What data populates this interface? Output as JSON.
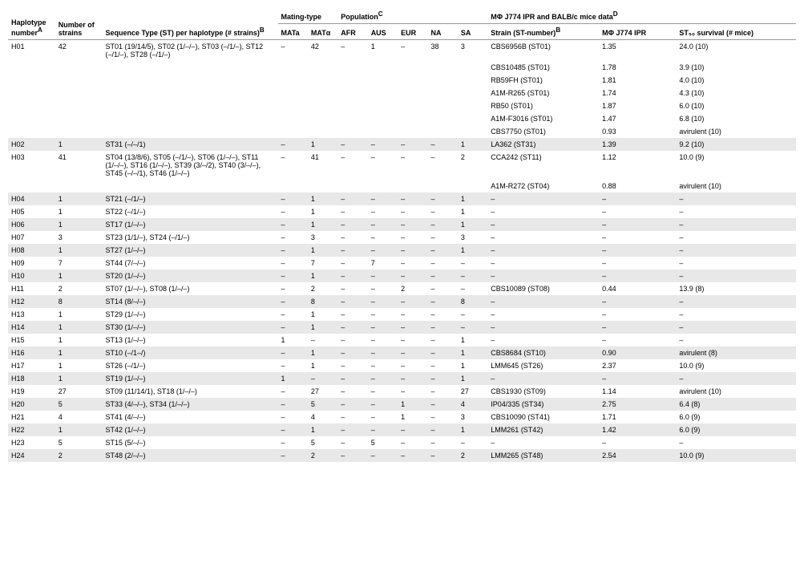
{
  "headers": {
    "haplotype": "Haplotype number",
    "haplotype_sup": "A",
    "nstrains": "Number of strains",
    "stper": "Sequence Type (ST) per haplotype (# strains)",
    "stper_sup": "B",
    "mating": "Mating-type",
    "MATa": "MATa",
    "MATalpha": "MATα",
    "population": "Population",
    "population_sup": "C",
    "AFR": "AFR",
    "AUS": "AUS",
    "EUR": "EUR",
    "NA": "NA",
    "SA": "SA",
    "mphi": "MΦ J774 IPR and BALB/c mice data",
    "mphi_sup": "D",
    "strain": "Strain (ST-number)",
    "strain_sup": "B",
    "ipr": "MΦ J774 IPR",
    "st50": "ST₅₀ survival (# mice)"
  },
  "chart_data": {
    "type": "table",
    "rows": [
      {
        "H": "H01",
        "N": "42",
        "ST": "ST01 (19/14/5), ST02 (1/–/–), ST03 (–/1/–), ST12 (–/1/–), ST28 (–/1/–)",
        "MATa": "–",
        "MATalpha": "42",
        "AFR": "–",
        "AUS": "1",
        "EUR": "–",
        "NA": "38",
        "SA": "3",
        "strain": "CBS6956B (ST01)",
        "IPR": "1.35",
        "ST50": "24.0 (10)"
      },
      {
        "H": "",
        "N": "",
        "ST": "",
        "MATa": "",
        "MATalpha": "",
        "AFR": "",
        "AUS": "",
        "EUR": "",
        "NA": "",
        "SA": "",
        "strain": "CBS10485 (ST01)",
        "IPR": "1.78",
        "ST50": "3.9 (10)"
      },
      {
        "H": "",
        "N": "",
        "ST": "",
        "MATa": "",
        "MATalpha": "",
        "AFR": "",
        "AUS": "",
        "EUR": "",
        "NA": "",
        "SA": "",
        "strain": "RB59FH (ST01)",
        "IPR": "1.81",
        "ST50": "4.0 (10)"
      },
      {
        "H": "",
        "N": "",
        "ST": "",
        "MATa": "",
        "MATalpha": "",
        "AFR": "",
        "AUS": "",
        "EUR": "",
        "NA": "",
        "SA": "",
        "strain": "A1M-R265 (ST01)",
        "IPR": "1.74",
        "ST50": "4.3 (10)"
      },
      {
        "H": "",
        "N": "",
        "ST": "",
        "MATa": "",
        "MATalpha": "",
        "AFR": "",
        "AUS": "",
        "EUR": "",
        "NA": "",
        "SA": "",
        "strain": "RB50 (ST01)",
        "IPR": "1.87",
        "ST50": "6.0 (10)"
      },
      {
        "H": "",
        "N": "",
        "ST": "",
        "MATa": "",
        "MATalpha": "",
        "AFR": "",
        "AUS": "",
        "EUR": "",
        "NA": "",
        "SA": "",
        "strain": "A1M-F3016 (ST01)",
        "IPR": "1.47",
        "ST50": "6.8 (10)"
      },
      {
        "H": "",
        "N": "",
        "ST": "",
        "MATa": "",
        "MATalpha": "",
        "AFR": "",
        "AUS": "",
        "EUR": "",
        "NA": "",
        "SA": "",
        "strain": "CBS7750 (ST01)",
        "IPR": "0.93",
        "ST50": "avirulent (10)"
      },
      {
        "H": "H02",
        "N": "1",
        "ST": "ST31 (–/–/1)",
        "MATa": "–",
        "MATalpha": "1",
        "AFR": "–",
        "AUS": "–",
        "EUR": "–",
        "NA": "–",
        "SA": "1",
        "strain": "LA362 (ST31)",
        "IPR": "1.39",
        "ST50": "9.2 (10)"
      },
      {
        "H": "H03",
        "N": "41",
        "ST": "ST04 (13/8/6), ST05 (–/1/–), ST06 (1/–/–), ST11 (1/–/–), ST16 (1/–/–), ST39 (3/–/2), ST40 (3/–/–), ST45 (–/–/1), ST46 (1/–/–)",
        "MATa": "–",
        "MATalpha": "41",
        "AFR": "–",
        "AUS": "–",
        "EUR": "–",
        "NA": "–",
        "SA": "2",
        "strain": "CCA242 (ST11)",
        "IPR": "1.12",
        "ST50": "10.0 (9)"
      },
      {
        "H": "",
        "N": "",
        "ST": "",
        "MATa": "",
        "MATalpha": "",
        "AFR": "",
        "AUS": "",
        "EUR": "",
        "NA": "",
        "SA": "",
        "strain": "A1M-R272 (ST04)",
        "IPR": "0.88",
        "ST50": "avirulent (10)"
      },
      {
        "H": "H04",
        "N": "1",
        "ST": "ST21 (–/1/–)",
        "MATa": "–",
        "MATalpha": "1",
        "AFR": "–",
        "AUS": "–",
        "EUR": "–",
        "NA": "–",
        "SA": "1",
        "strain": "–",
        "IPR": "–",
        "ST50": "–"
      },
      {
        "H": "H05",
        "N": "1",
        "ST": "ST22 (–/1/–)",
        "MATa": "–",
        "MATalpha": "1",
        "AFR": "–",
        "AUS": "–",
        "EUR": "–",
        "NA": "–",
        "SA": "1",
        "strain": "–",
        "IPR": "–",
        "ST50": "–"
      },
      {
        "H": "H06",
        "N": "1",
        "ST": "ST17 (1/–/–)",
        "MATa": "–",
        "MATalpha": "1",
        "AFR": "–",
        "AUS": "–",
        "EUR": "–",
        "NA": "–",
        "SA": "1",
        "strain": "–",
        "IPR": "–",
        "ST50": "–"
      },
      {
        "H": "H07",
        "N": "3",
        "ST": "ST23 (1/1/–), ST24 (–/1/–)",
        "MATa": "–",
        "MATalpha": "3",
        "AFR": "–",
        "AUS": "–",
        "EUR": "–",
        "NA": "–",
        "SA": "3",
        "strain": "–",
        "IPR": "–",
        "ST50": "–"
      },
      {
        "H": "H08",
        "N": "1",
        "ST": "ST27 (1/–/–)",
        "MATa": "–",
        "MATalpha": "1",
        "AFR": "–",
        "AUS": "–",
        "EUR": "–",
        "NA": "–",
        "SA": "1",
        "strain": "–",
        "IPR": "–",
        "ST50": "–"
      },
      {
        "H": "H09",
        "N": "7",
        "ST": "ST44 (7/–/–)",
        "MATa": "–",
        "MATalpha": "7",
        "AFR": "–",
        "AUS": "7",
        "EUR": "–",
        "NA": "–",
        "SA": "–",
        "strain": "–",
        "IPR": "–",
        "ST50": "–"
      },
      {
        "H": "H10",
        "N": "1",
        "ST": "ST20 (1/–/–)",
        "MATa": "–",
        "MATalpha": "1",
        "AFR": "–",
        "AUS": "–",
        "EUR": "–",
        "NA": "–",
        "SA": "–",
        "strain": "–",
        "IPR": "–",
        "ST50": "–"
      },
      {
        "H": "H11",
        "N": "2",
        "ST": "ST07 (1/–/–), ST08 (1/–/–)",
        "MATa": "–",
        "MATalpha": "2",
        "AFR": "–",
        "AUS": "–",
        "EUR": "2",
        "NA": "–",
        "SA": "–",
        "strain": "CBS10089 (ST08)",
        "IPR": "0.44",
        "ST50": "13.9 (8)"
      },
      {
        "H": "H12",
        "N": "8",
        "ST": "ST14 (8/–/–)",
        "MATa": "–",
        "MATalpha": "8",
        "AFR": "–",
        "AUS": "–",
        "EUR": "–",
        "NA": "–",
        "SA": "8",
        "strain": "–",
        "IPR": "–",
        "ST50": "–"
      },
      {
        "H": "H13",
        "N": "1",
        "ST": "ST29 (1/–/–)",
        "MATa": "–",
        "MATalpha": "1",
        "AFR": "–",
        "AUS": "–",
        "EUR": "–",
        "NA": "–",
        "SA": "–",
        "strain": "–",
        "IPR": "–",
        "ST50": "–"
      },
      {
        "H": "H14",
        "N": "1",
        "ST": "ST30 (1/–/–)",
        "MATa": "–",
        "MATalpha": "1",
        "AFR": "–",
        "AUS": "–",
        "EUR": "–",
        "NA": "–",
        "SA": "–",
        "strain": "–",
        "IPR": "–",
        "ST50": "–"
      },
      {
        "H": "H15",
        "N": "1",
        "ST": "ST13 (1/–/–)",
        "MATa": "1",
        "MATalpha": "–",
        "AFR": "–",
        "AUS": "–",
        "EUR": "–",
        "NA": "–",
        "SA": "1",
        "strain": "–",
        "IPR": "–",
        "ST50": "–"
      },
      {
        "H": "H16",
        "N": "1",
        "ST": "ST10 (–/1–/)",
        "MATa": "–",
        "MATalpha": "1",
        "AFR": "–",
        "AUS": "–",
        "EUR": "–",
        "NA": "–",
        "SA": "1",
        "strain": "CBS8684 (ST10)",
        "IPR": "0.90",
        "ST50": "avirulent (8)"
      },
      {
        "H": "H17",
        "N": "1",
        "ST": "ST26 (–/1/–)",
        "MATa": "–",
        "MATalpha": "1",
        "AFR": "–",
        "AUS": "–",
        "EUR": "–",
        "NA": "–",
        "SA": "1",
        "strain": "LMM645 (ST26)",
        "IPR": "2.37",
        "ST50": "10.0 (9)"
      },
      {
        "H": "H18",
        "N": "1",
        "ST": "ST19 (1/–/–)",
        "MATa": "1",
        "MATalpha": "–",
        "AFR": "–",
        "AUS": "–",
        "EUR": "–",
        "NA": "–",
        "SA": "1",
        "strain": "–",
        "IPR": "–",
        "ST50": "–"
      },
      {
        "H": "H19",
        "N": "27",
        "ST": "ST09 (11/14/1), ST18 (1/–/–)",
        "MATa": "–",
        "MATalpha": "27",
        "AFR": "–",
        "AUS": "–",
        "EUR": "–",
        "NA": "–",
        "SA": "27",
        "strain": "CBS1930 (ST09)",
        "IPR": "1.14",
        "ST50": "avirulent (10)"
      },
      {
        "H": "H20",
        "N": "5",
        "ST": "ST33 (4/–/–), ST34 (1/–/–)",
        "MATa": "–",
        "MATalpha": "5",
        "AFR": "–",
        "AUS": "–",
        "EUR": "1",
        "NA": "–",
        "SA": "4",
        "strain": "IP04/335 (ST34)",
        "IPR": "2.75",
        "ST50": "6.4 (8)"
      },
      {
        "H": "H21",
        "N": "4",
        "ST": "ST41 (4/–/–)",
        "MATa": "–",
        "MATalpha": "4",
        "AFR": "–",
        "AUS": "–",
        "EUR": "1",
        "NA": "–",
        "SA": "3",
        "strain": "CBS10090 (ST41)",
        "IPR": "1.71",
        "ST50": "6.0 (9)"
      },
      {
        "H": "H22",
        "N": "1",
        "ST": "ST42 (1/–/–)",
        "MATa": "–",
        "MATalpha": "1",
        "AFR": "–",
        "AUS": "–",
        "EUR": "–",
        "NA": "–",
        "SA": "1",
        "strain": "LMM261 (ST42)",
        "IPR": "1.42",
        "ST50": "6.0 (9)"
      },
      {
        "H": "H23",
        "N": "5",
        "ST": "ST15 (5/–/–)",
        "MATa": "–",
        "MATalpha": "5",
        "AFR": "–",
        "AUS": "5",
        "EUR": "–",
        "NA": "–",
        "SA": "–",
        "strain": "–",
        "IPR": "–",
        "ST50": "–"
      },
      {
        "H": "H24",
        "N": "2",
        "ST": "ST48 (2/–/–)",
        "MATa": "–",
        "MATalpha": "2",
        "AFR": "–",
        "AUS": "–",
        "EUR": "–",
        "NA": "–",
        "SA": "2",
        "strain": "LMM265 (ST48)",
        "IPR": "2.54",
        "ST50": "10.0 (9)"
      }
    ]
  }
}
